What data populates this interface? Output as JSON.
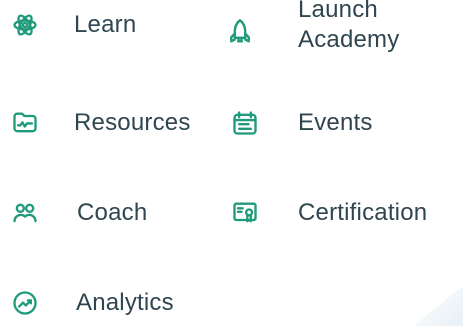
{
  "menu": {
    "items": [
      {
        "label": "Learn",
        "icon": "atom-icon"
      },
      {
        "label": "Launch Academy",
        "icon": "rocket-icon"
      },
      {
        "label": "Resources",
        "icon": "folder-chart-icon"
      },
      {
        "label": "Events",
        "icon": "calendar-icon"
      },
      {
        "label": "Coach",
        "icon": "users-icon"
      },
      {
        "label": "Certification",
        "icon": "certificate-icon"
      },
      {
        "label": "Analytics",
        "icon": "trend-up-icon"
      }
    ]
  },
  "theme": {
    "accent": "#1f9a7a",
    "text": "#2f4650"
  }
}
